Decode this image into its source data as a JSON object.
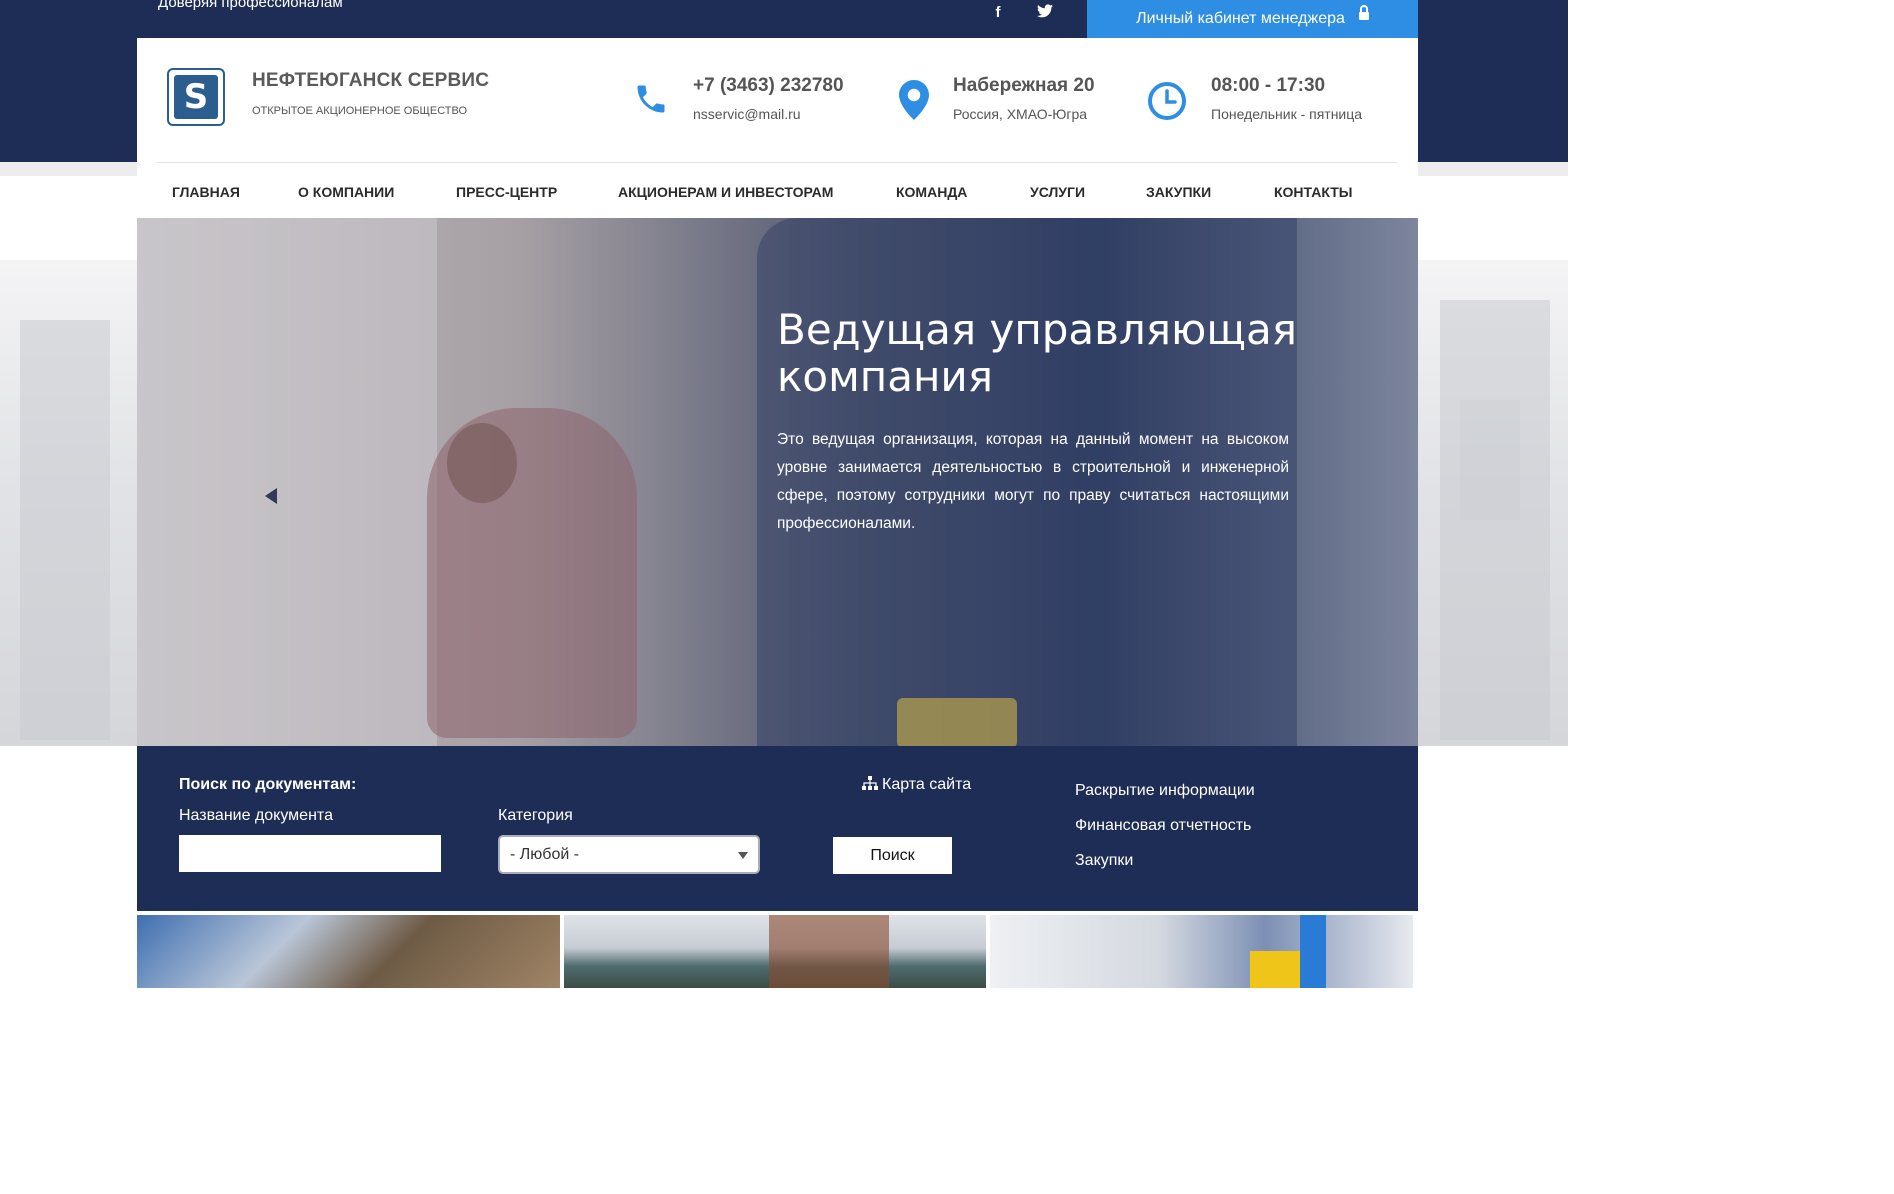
{
  "topbar": {
    "tagline": "Доверяя профессионалам",
    "social": [
      {
        "name": "facebook",
        "glyph": "f"
      },
      {
        "name": "twitter",
        "glyph": "t"
      }
    ],
    "cabinet_label": "Личный кабинет менеджера"
  },
  "brand": {
    "logo_letter": "S",
    "name": "НЕФТЕЮГАНСК СЕРВИС",
    "subtitle": "ОТКРЫТОЕ АКЦИОНЕРНОЕ ОБЩЕСТВО"
  },
  "contacts": {
    "phone": "+7 (3463) 232780",
    "email": "nsservic@mail.ru",
    "address_main": "Набережная 20",
    "address_sub": "Россия, ХМАО-Югра",
    "hours_main": "08:00 - 17:30",
    "hours_sub": "Понедельник - пятница"
  },
  "nav": [
    "ГЛАВНАЯ",
    "О КОМПАНИИ",
    "ПРЕСС-ЦЕНТР",
    "АКЦИОНЕРАМ И ИНВЕСТОРАМ",
    "КОМАНДА",
    "УСЛУГИ",
    "ЗАКУПКИ",
    "КОНТАКТЫ"
  ],
  "hero": {
    "title": "Ведущая управляющая компания",
    "text": "Это ведущая организация, которая на данный момент на высоком уровне занимается деятельностью в строительной и инженерной сфере, поэтому сотрудники могут по праву считаться настоящими профессионалами."
  },
  "search": {
    "title": "Поиск по документам:",
    "doc_label": "Название документа",
    "doc_value": "",
    "category_label": "Категория",
    "category_value": "- Любой -",
    "button": "Поиск",
    "sitemap": "Карта сайта"
  },
  "side_links": [
    "Раскрытие информации",
    "Финансовая отчетность",
    "Закупки"
  ],
  "colors": {
    "navy": "#1e2d55",
    "accent_blue": "#2e8ee3",
    "icon_blue": "#2e8ee3"
  }
}
